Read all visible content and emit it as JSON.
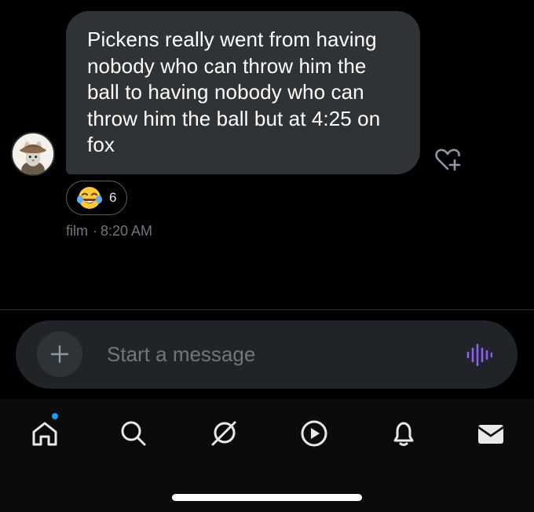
{
  "message": {
    "text": "Pickens really went from having nobody who can throw him the ball to having nobody who can throw him the ball but at 4:25 on fox",
    "sender_name": "film",
    "timestamp": "8:20 AM",
    "separator": "·",
    "reaction": {
      "emoji_icon": "tears-of-joy-emoji-icon",
      "count": "6"
    }
  },
  "composer": {
    "placeholder": "Start a message",
    "add_icon": "plus-icon",
    "voice_icon": "voice-waveform-icon",
    "accent_color": "#8b5cf6"
  },
  "tabbar": {
    "items": [
      {
        "name": "home",
        "icon": "home-icon",
        "has_badge": true
      },
      {
        "name": "search",
        "icon": "search-icon"
      },
      {
        "name": "grok",
        "icon": "grok-icon"
      },
      {
        "name": "video",
        "icon": "play-icon"
      },
      {
        "name": "notifications",
        "icon": "bell-icon"
      },
      {
        "name": "messages",
        "icon": "envelope-icon",
        "active": true
      }
    ],
    "badge_color": "#1d9bf0"
  },
  "colors": {
    "background": "#000000",
    "bubble": "#2f3336",
    "muted_text": "#71767b"
  }
}
